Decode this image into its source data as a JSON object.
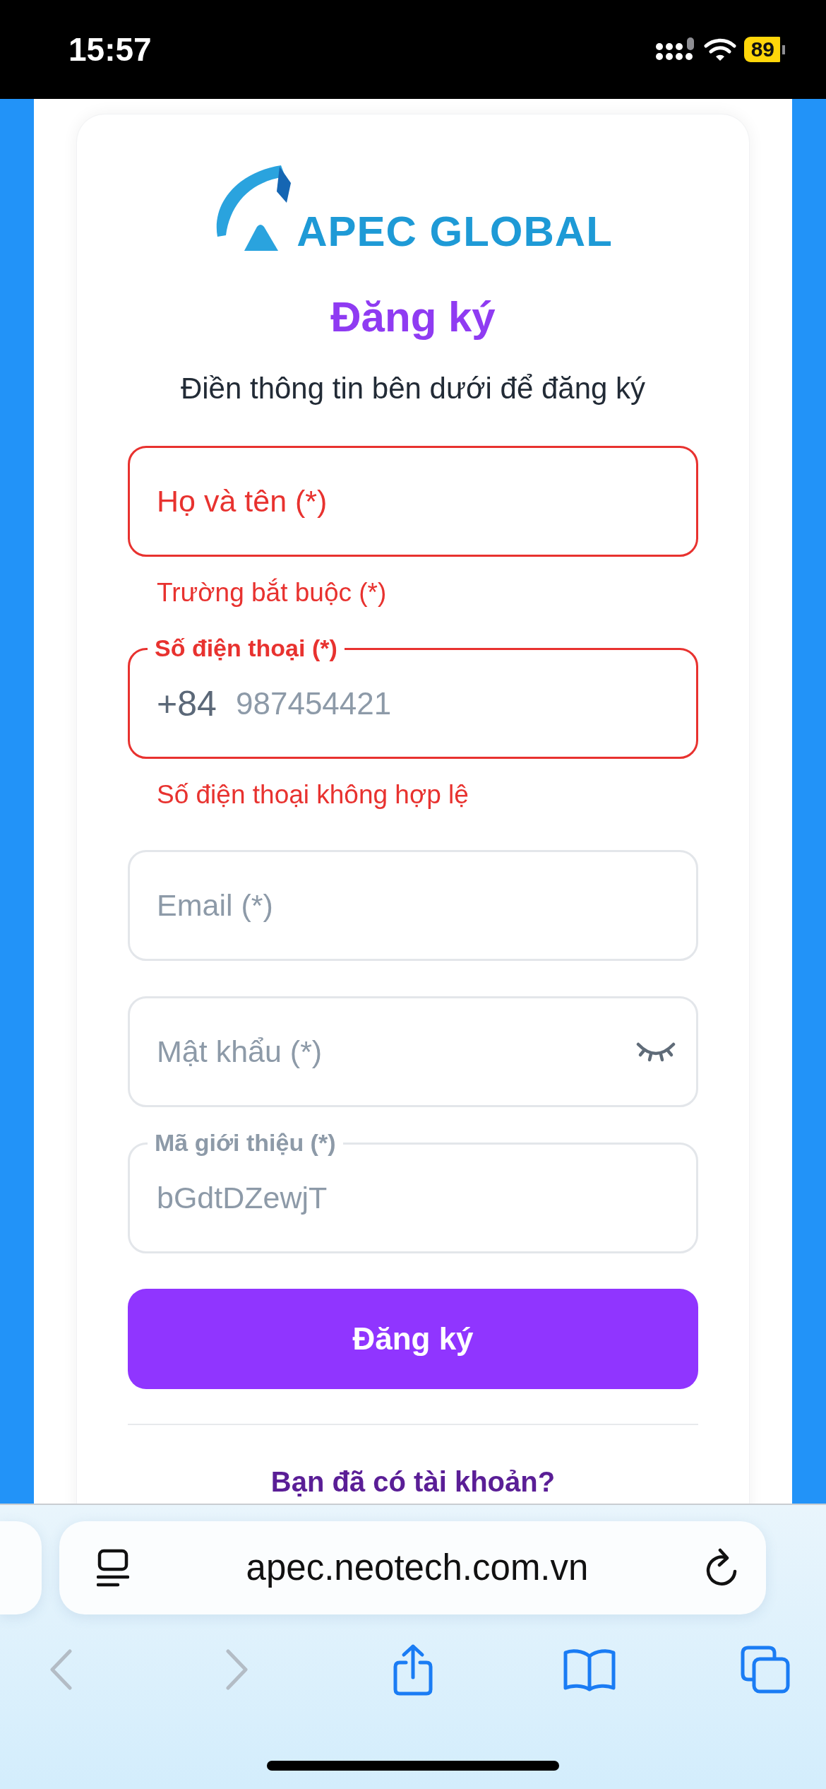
{
  "status_bar": {
    "time": "15:57",
    "battery": "89"
  },
  "logo": {
    "text": "APEC GLOBAL"
  },
  "title": "Đăng ký",
  "subtitle": "Điền thông tin bên dưới để đăng ký",
  "fields": [
    {
      "kind": "text",
      "placeholder": "Họ và tên (*)",
      "invalid": true,
      "error": "Trường bắt buộc (*)"
    },
    {
      "kind": "phone",
      "label": "Số điện thoại (*)",
      "prefix": "+84",
      "placeholder": "987454421",
      "invalid": true,
      "error": "Số điện thoại không hợp lệ"
    },
    {
      "kind": "text",
      "placeholder": "Email (*)",
      "invalid": false
    },
    {
      "kind": "password",
      "placeholder": "Mật khẩu (*)",
      "invalid": false
    },
    {
      "kind": "text",
      "label": "Mã giới thiệu (*)",
      "value": "bGdtDZewjT",
      "invalid": false
    }
  ],
  "submit_button": "Đăng ký",
  "login_prompt": "Bạn đã có tài khoản?",
  "browser": {
    "url": "apec.neotech.com.vn",
    "toolbar": [
      {
        "kind": "back",
        "disabled": true
      },
      {
        "kind": "forward",
        "disabled": true
      },
      {
        "kind": "share",
        "disabled": false
      },
      {
        "kind": "bookmarks",
        "disabled": false
      },
      {
        "kind": "tabs",
        "disabled": false
      }
    ]
  }
}
